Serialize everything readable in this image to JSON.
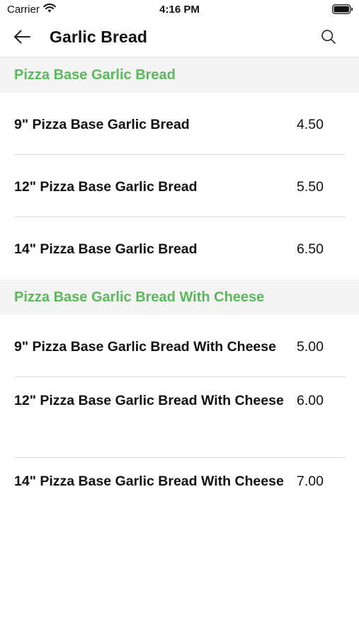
{
  "status_bar": {
    "carrier": "Carrier",
    "time": "4:16 PM",
    "wifi_icon": "wifi-icon",
    "battery_icon": "battery-icon"
  },
  "nav": {
    "title": "Garlic Bread",
    "back_icon": "arrow-left-icon",
    "search_icon": "search-icon"
  },
  "colors": {
    "accent": "#5cb85c",
    "section_bg": "#f4f4f4",
    "divider": "#dcdcdc"
  },
  "sections": [
    {
      "title": "Pizza Base Garlic Bread",
      "items": [
        {
          "name": "9\" Pizza Base Garlic Bread",
          "price": "4.50"
        },
        {
          "name": "12\" Pizza Base Garlic Bread",
          "price": "5.50"
        },
        {
          "name": "14\" Pizza Base Garlic Bread",
          "price": "6.50"
        }
      ]
    },
    {
      "title": "Pizza Base Garlic Bread With Cheese",
      "items": [
        {
          "name": "9\" Pizza Base Garlic Bread With Cheese",
          "price": "5.00"
        },
        {
          "name": "12\" Pizza Base Garlic Bread With Cheese",
          "price": "6.00"
        },
        {
          "name": "14\" Pizza Base Garlic Bread With Cheese",
          "price": "7.00"
        }
      ]
    }
  ]
}
